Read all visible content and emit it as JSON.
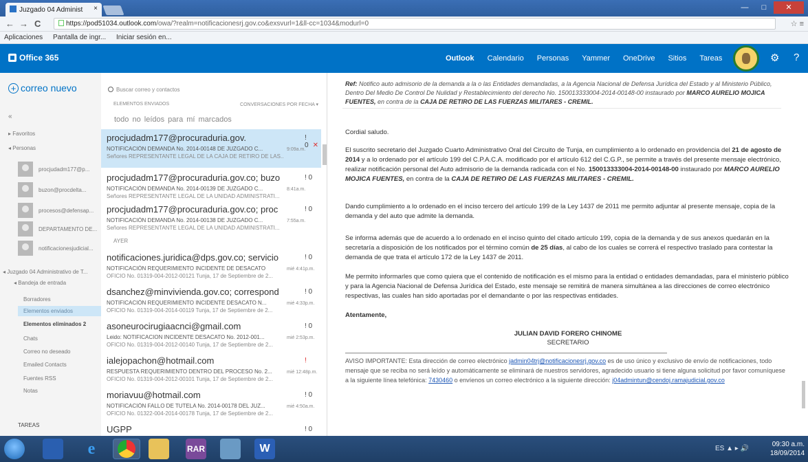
{
  "browser": {
    "tab_title": "Juzgado 04 Administ",
    "tab_close": "×",
    "url_host": "https://pod51034.outlook.com",
    "url_rest": "/owa/?realm=notificacionesrj.gov.co&exsvurl=1&ll-cc=1034&modurl=0",
    "nav_back": "←",
    "nav_forward": "→",
    "nav_reload": "C",
    "addr_icons": "☆ ≡",
    "bookmarks": [
      "Aplicaciones",
      "Pantalla de ingr...",
      "Iniciar sesión en..."
    ],
    "win_min": "—",
    "win_max": "□",
    "win_close": "✕"
  },
  "o365": {
    "logo": "Office 365",
    "nav": [
      "Outlook",
      "Calendario",
      "Personas",
      "Yammer",
      "OneDrive",
      "Sitios",
      "Tareas"
    ],
    "gear": "⚙",
    "help": "?"
  },
  "leftnav": {
    "new_mail": "correo nuevo",
    "new_mail_icon": "+",
    "collapse": "«",
    "favoritos": "▸ Favoritos",
    "people_header": "◂ Personas",
    "people": [
      "procjudadm177@p...",
      "buzon@procdelta...",
      "procesos@defensap...",
      "DEPARTAMENTO DE...",
      "notificacionesjudicial..."
    ],
    "account": "◂ Juzgado 04 Administrativo de T...",
    "inbox": "◂ Bandeja de entrada",
    "folders": [
      "Borradores",
      "Elementos enviados",
      "Elementos eliminados 2",
      "Chats",
      "Correo no deseado",
      "Emailed Contacts",
      "Fuentes RSS",
      "Notas"
    ],
    "tareas": "TAREAS"
  },
  "msglist": {
    "search_placeholder": "Buscar correo y contactos",
    "header_left": "ELEMENTOS ENVIADOS",
    "header_right": "CONVERSACIONES POR FECHA ▾",
    "filters": "todo  no leídos  para mí  marcados",
    "divider": "AYER",
    "messages": [
      {
        "sender": "procjudadm177@procuraduria.gov.",
        "subject": "NOTIFICACIÓN DEMANDA No. 2014-00148 DE JUZGADO C...",
        "preview": "Señores REPRESENTANTE LEGAL DE LA CAJA DE RETIRO DE LAS...",
        "time": "9:09a.m.",
        "flags": "! 0",
        "x": "✕"
      },
      {
        "sender": "procjudadm177@procuraduria.gov.co; buzo",
        "subject": "NOTIFICACIÓN DEMANDA No. 2014-00139 DE JUZGADO C...",
        "preview": "Señores REPRESENTANTE LEGAL DE LA UNIDAD ADMINISTRATI...",
        "time": "8:41a.m.",
        "flags": "! 0"
      },
      {
        "sender": "procjudadm177@procuraduria.gov.co; proc",
        "subject": "NOTIFICACIÓN DEMANDA No. 2014-00138 DE JUZGADO C...",
        "preview": "Señores REPRESENTANTE LEGAL DE LA UNIDAD ADMINISTRATI...",
        "time": "7:55a.m.",
        "flags": "! 0"
      },
      {
        "sender": "notificaciones.juridica@dps.gov.co; servicio",
        "subject": "NOTIFICACIÓN REQUERIMIENTO INCIDENTE DE DESACATO",
        "preview": "OFICIO No. 01319-004-2012-00121 Tunja, 17 de Septiembre de 2...",
        "time": "mié 4:41p.m.",
        "flags": "! 0"
      },
      {
        "sender": "dsanchez@minvivienda.gov.co; correspond",
        "subject": "NOTIFICACIÓN REQUERIMIENTO INCIDENTE DESACATO N...",
        "preview": "OFICIO No. 01319-004-2014-00119 Tunja, 17 de Septiembre de 2...",
        "time": "mié 4:33p.m.",
        "flags": "! 0"
      },
      {
        "sender": "asoneurocirugiaacnci@gmail.com",
        "subject": "Leido: NOTIFICACION INCIDENTE DESACATO No. 2012-001...",
        "preview": "OFICIO No. 01319-004-2012-00140 Tunja, 17 de Septiembre de 2...",
        "time": "mié 2:53p.m.",
        "flags": "! 0"
      },
      {
        "sender": "ialejopachon@hotmail.com",
        "subject": "RESPUESTA REQUERIMIENTO DENTRO DEL PROCESO No. 2...",
        "preview": "OFICIO No. 01319-004-2012-00101 Tunja, 17 de Septiembre de 2...",
        "time": "mié 12:48p.m.",
        "flags": "!"
      },
      {
        "sender": "moriavuu@hotmail.com",
        "subject": "NOTIFICACIÓN FALLO DE TUTELA No. 2014-00178 DEL JUZ...",
        "preview": "OFICIO No. 01322-004-2014-00178 Tunja, 17 de Septiembre de 2...",
        "time": "mié 4:50a.m.",
        "flags": "! 0"
      },
      {
        "sender": "UGPP",
        "subject": "",
        "preview": "",
        "time": "",
        "flags": "! 0"
      }
    ]
  },
  "pane": {
    "ref_label": "Ref:",
    "ref_text": "Notifico auto admisorio de la demanda a la o las Entidades demandadas, a la Agencia Nacional de Defensa Jurídica del Estado y al Ministerio Público, Dentro Del Medio De Control De Nulidad y Restablecimiento del derecho No. 150013333004-2014-00148-00 instaurado por",
    "ref_plaintiff": "MARCO AURELIO MOJICA FUENTES,",
    "ref_mid": " en contra de la ",
    "ref_defendant": "CAJA DE RETIRO DE LAS FUERZAS MILITARES - CREMIL.",
    "greeting": "Cordial saludo.",
    "p1_a": "El suscrito secretario del Juzgado Cuarto Administrativo Oral del Circuito de Tunja, en cumplimiento a lo ordenado en providencia del ",
    "p1_date": "21 de agosto de 2014",
    "p1_b": " y a lo ordenado por el artículo 199 del C.P.A.C.A. modificado por el artículo 612 del C.G.P., se permite a través del presente mensaje electrónico, realizar notificación personal del Auto admisorio de la demanda radicada con el No. ",
    "p1_num": "150013333004-2014-00148-00",
    "p1_c": " instaurado por ",
    "p1_plaintiff": "MARCO AURELIO MOJICA FUENTES,",
    "p1_d": " en contra de la ",
    "p1_defendant": "CAJA DE RETIRO DE LAS FUERZAS MILITARES - CREMIL.",
    "p2": "Dando cumplimiento a lo ordenado en el inciso tercero del artículo 199 de la Ley 1437 de 2011 me permito adjuntar al presente mensaje, copia de la demanda y del auto que admite la demanda.",
    "p3_a": "Se informa además que de acuerdo a lo ordenado en el inciso quinto del citado artículo 199, copia de la demanda y de sus anexos quedarán en la secretaría a disposición de los notificados por el término común ",
    "p3_days": "de 25 días",
    "p3_b": ", al cabo de los cuales se correrá el respectivo traslado para contestar la demanda de que trata el artículo 172 de la Ley 1437 de 2011.",
    "p4": "Me permito informarles que como quiera que el contenido de notificación es el mismo para la entidad o entidades demandadas, para el ministerio público y para la Agencia Nacional de Defensa Jurídica del Estado, este mensaje se remitirá de manera simultánea a las direcciones de correo electrónico respectivas, las cuales han sido aportadas por el demandante o por las respectivas entidades.",
    "closing": "Atentamente,",
    "signer": "JULIAN DAVID FORERO CHINOME",
    "role": "SECRETARIO",
    "aviso_a": "AVISO IMPORTANTE: Esta dirección de correo electrónico ",
    "aviso_email": "jadmin04trj@notificacionesrj.gov.co",
    "aviso_b": " es de uso único y exclusivo de envío de notificaciones, todo mensaje que se reciba no será leído y automáticamente se eliminará de nuestros servidores, agradecido usuario si tiene alguna solicitud por favor comuníquese a la siguiente línea telefónica: ",
    "aviso_phone": "7430460",
    "aviso_c": " o envíenos un correo electrónico a la siguiente dirección: ",
    "aviso_email2": "j04admintun@cendoj.ramajudicial.gov.co"
  },
  "taskbar": {
    "ie": "e",
    "rar": "RAR",
    "word": "W",
    "tray": "ES ▲ ▸ 🔊",
    "time": "09:30 a.m.",
    "date": "18/09/2014"
  }
}
